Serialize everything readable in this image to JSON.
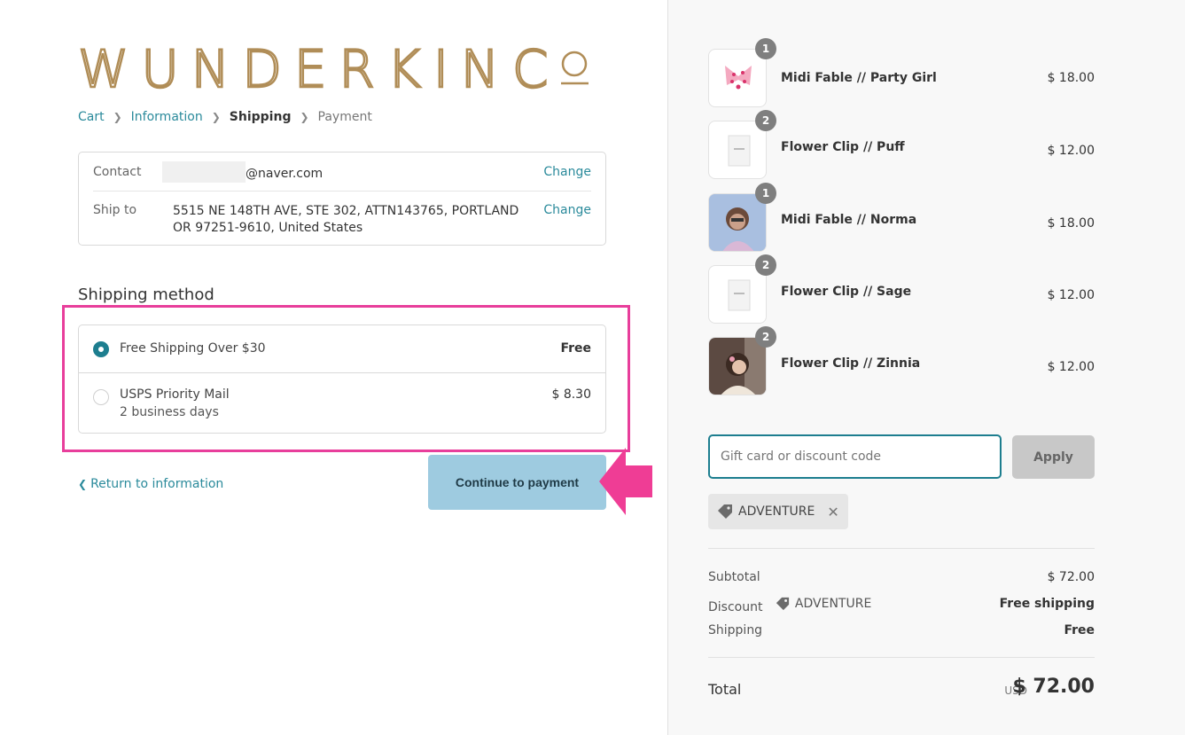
{
  "brand": {
    "logo_text": "WUNDERKIN CO",
    "gold": "#b08d57"
  },
  "breadcrumb": {
    "cart": "Cart",
    "information": "Information",
    "shipping": "Shipping",
    "payment": "Payment"
  },
  "review": {
    "contact_label": "Contact",
    "contact_value": "@naver.com",
    "ship_label": "Ship to",
    "ship_value": "5515 NE 148TH AVE, STE 302, ATTN143765, PORTLAND OR 97251-9610, United States",
    "change": "Change"
  },
  "shipping": {
    "title": "Shipping method",
    "methods": [
      {
        "name": "Free Shipping Over $30",
        "sub": "",
        "price": "Free",
        "selected": true
      },
      {
        "name": "USPS Priority Mail",
        "sub": "2 business days",
        "price": "$ 8.30",
        "selected": false
      }
    ]
  },
  "actions": {
    "return": "Return to information",
    "continue": "Continue to payment"
  },
  "cart": {
    "items": [
      {
        "name": "Midi Fable // Party Girl",
        "qty": "1",
        "price": "$ 18.00",
        "icon": "pink-bow-image"
      },
      {
        "name": "Flower Clip // Puff",
        "qty": "2",
        "price": "$ 12.00",
        "icon": "clip-card-image"
      },
      {
        "name": "Midi Fable // Norma",
        "qty": "1",
        "price": "$ 18.00",
        "icon": "child-photo"
      },
      {
        "name": "Flower Clip // Sage",
        "qty": "2",
        "price": "$ 12.00",
        "icon": "clip-card-image"
      },
      {
        "name": "Flower Clip // Zinnia",
        "qty": "2",
        "price": "$ 12.00",
        "icon": "child-photo"
      }
    ]
  },
  "discount": {
    "placeholder": "Gift card or discount code",
    "apply": "Apply",
    "code": "ADVENTURE"
  },
  "summary": {
    "subtotal_label": "Subtotal",
    "subtotal": "$ 72.00",
    "discount_label": "Discount",
    "discount_code": "ADVENTURE",
    "discount_value": "Free shipping",
    "shipping_label": "Shipping",
    "shipping_value": "Free",
    "total_label": "Total",
    "currency": "USD",
    "total": "$ 72.00"
  },
  "colors": {
    "accent": "#2a8a9b",
    "highlight": "#e83e9b",
    "button": "#9ecbe0"
  }
}
